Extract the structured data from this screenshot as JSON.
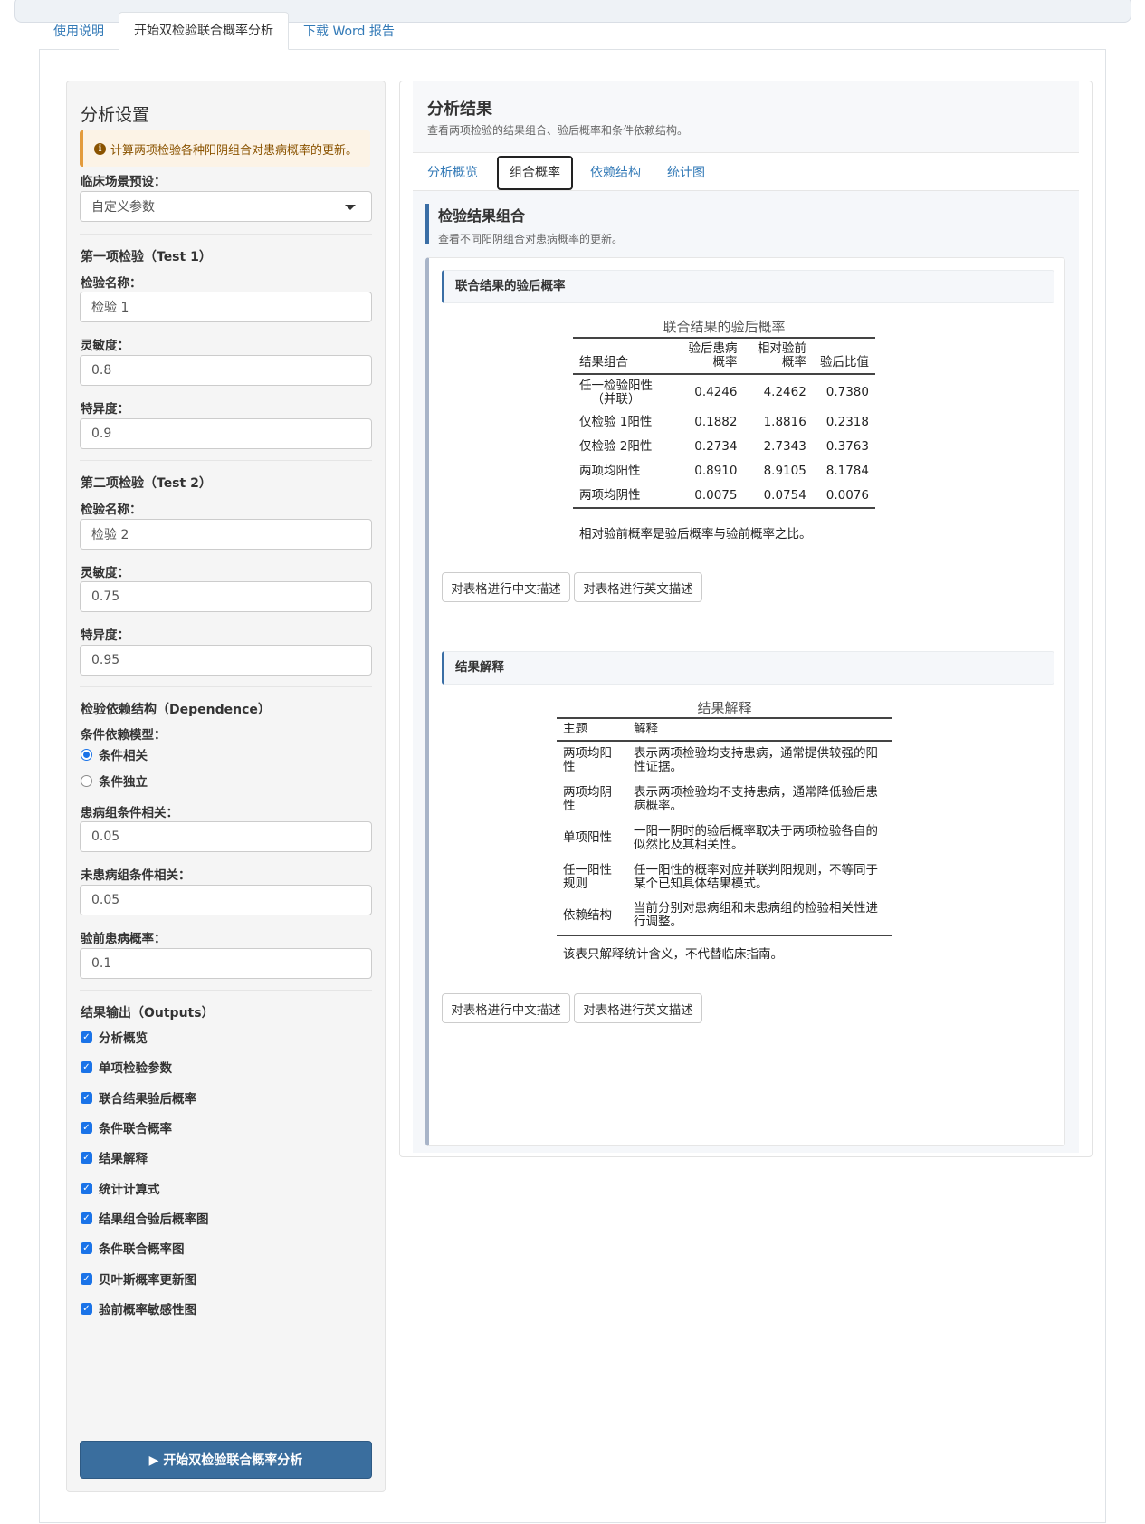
{
  "tabs": [
    "使用说明",
    "开始双检验联合概率分析",
    "下载 Word 报告"
  ],
  "sidebar": {
    "title": "分析设置",
    "alert": "计算两项检验各种阳阴组合对患病概率的更新。",
    "preset_label": "临床场景预设：",
    "preset_value": "自定义参数",
    "test1_header": "第一项检验（Test 1）",
    "test1_name_label": "检验名称：",
    "test1_name": "检验 1",
    "test1_sens_label": "灵敏度：",
    "test1_sens": "0.8",
    "test1_spec_label": "特异度：",
    "test1_spec": "0.9",
    "test2_header": "第二项检验（Test 2）",
    "test2_name_label": "检验名称：",
    "test2_name": "检验 2",
    "test2_sens_label": "灵敏度：",
    "test2_sens": "0.75",
    "test2_spec_label": "特异度：",
    "test2_spec": "0.95",
    "dep_header": "检验依赖结构（Dependence）",
    "dep_model_label": "条件依赖模型：",
    "dep_options": [
      "条件相关",
      "条件独立"
    ],
    "corr_d_label": "患病组条件相关：",
    "corr_d": "0.05",
    "corr_nd_label": "未患病组条件相关：",
    "corr_nd": "0.05",
    "prior_label": "验前患病概率：",
    "prior": "0.1",
    "outputs_header": "结果输出（Outputs）",
    "outputs": [
      "分析概览",
      "单项检验参数",
      "联合结果验后概率",
      "条件联合概率",
      "结果解释",
      "统计计算式",
      "结果组合验后概率图",
      "条件联合概率图",
      "贝叶斯概率更新图",
      "验前概率敏感性图"
    ],
    "run_button": "▶ 开始双检验联合概率分析"
  },
  "results": {
    "title": "分析结果",
    "subtitle": "查看两项检验的结果组合、验后概率和条件依赖结构。",
    "subtabs": [
      "分析概览",
      "组合概率",
      "依赖结构",
      "统计图"
    ],
    "section_title": "检验结果组合",
    "section_sub": "查看不同阳阴组合对患病概率的更新。",
    "card1_header": "联合结果的验后概率",
    "table1": {
      "title": "联合结果的验后概率",
      "headers": [
        "结果组合",
        "验后患病\n概率",
        "相对验前\n概率",
        "验后比值"
      ],
      "rows": [
        [
          "任一检验阳性\n（并联）",
          "0.4246",
          "4.2462",
          "0.7380"
        ],
        [
          "仅检验 1阳性",
          "0.1882",
          "1.8816",
          "0.2318"
        ],
        [
          "仅检验 2阳性",
          "0.2734",
          "2.7343",
          "0.3763"
        ],
        [
          "两项均阳性",
          "0.8910",
          "8.9105",
          "8.1784"
        ],
        [
          "两项均阴性",
          "0.0075",
          "0.0754",
          "0.0076"
        ]
      ],
      "footnote": "相对验前概率是验后概率与验前概率之比。"
    },
    "card2_header": "结果解释",
    "table2": {
      "title": "结果解释",
      "headers": [
        "主题",
        "解释"
      ],
      "rows": [
        [
          "两项均阳\n性",
          "表示两项检验均支持患病，通常提供较强的阳\n性证据。"
        ],
        [
          "两项均阴\n性",
          "表示两项检验均不支持患病，通常降低验后患\n病概率。"
        ],
        [
          "单项阳性",
          "一阳一阴时的验后概率取决于两项检验各自的\n似然比及其相关性。"
        ],
        [
          "任一阳性\n规则",
          "任一阳性的概率对应并联判阳规则，不等同于\n某个已知具体结果模式。"
        ],
        [
          "依赖结构",
          "当前分别对患病组和未患病组的检验相关性进\n行调整。"
        ]
      ],
      "footnote": "该表只解释统计含义，不代替临床指南。"
    },
    "btn_cn": "对表格进行中文描述",
    "btn_en": "对表格进行英文描述"
  }
}
